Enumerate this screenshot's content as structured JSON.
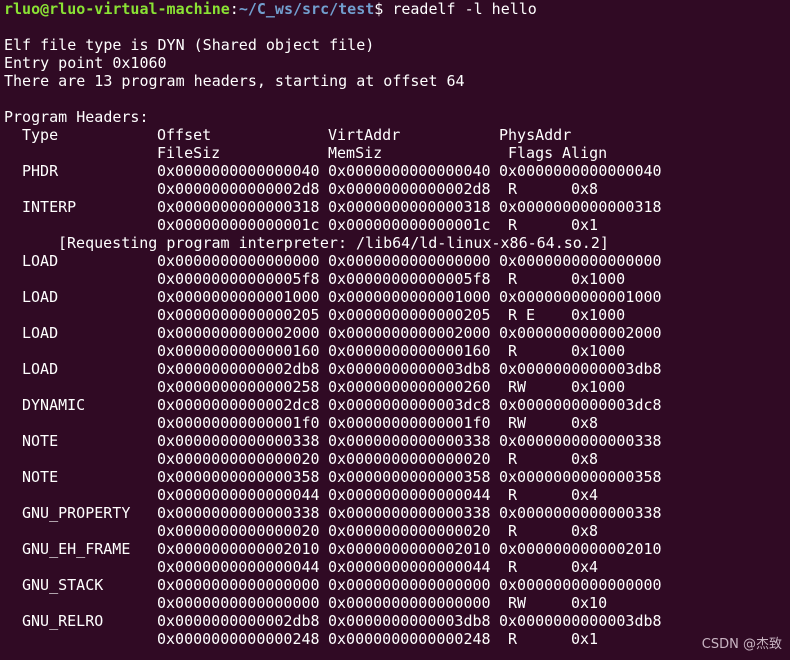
{
  "prompt": {
    "user_host": "rluo@rluo-virtual-machine",
    "separator": ":",
    "path": "~/C_ws/src/test",
    "symbol": "$ ",
    "command": "readelf -l hello"
  },
  "info": {
    "file_type": "Elf file type is DYN (Shared object file)",
    "entry_point": "Entry point 0x1060",
    "header_count": "There are 13 program headers, starting at offset 64"
  },
  "headers_title": "Program Headers:",
  "columns": {
    "type": "Type",
    "offset": "Offset",
    "virtaddr": "VirtAddr",
    "physaddr": "PhysAddr",
    "filesiz": "FileSiz",
    "memsiz": "MemSiz",
    "flags": "Flags",
    "align": "Align"
  },
  "rows": [
    {
      "type": "PHDR",
      "offset": "0x0000000000000040",
      "virtaddr": "0x0000000000000040",
      "physaddr": "0x0000000000000040",
      "filesiz": "0x00000000000002d8",
      "memsiz": "0x00000000000002d8",
      "flags": "R",
      "align": "0x8"
    },
    {
      "type": "INTERP",
      "offset": "0x0000000000000318",
      "virtaddr": "0x0000000000000318",
      "physaddr": "0x0000000000000318",
      "filesiz": "0x000000000000001c",
      "memsiz": "0x000000000000001c",
      "flags": "R",
      "align": "0x1",
      "note": "[Requesting program interpreter: /lib64/ld-linux-x86-64.so.2]"
    },
    {
      "type": "LOAD",
      "offset": "0x0000000000000000",
      "virtaddr": "0x0000000000000000",
      "physaddr": "0x0000000000000000",
      "filesiz": "0x00000000000005f8",
      "memsiz": "0x00000000000005f8",
      "flags": "R",
      "align": "0x1000"
    },
    {
      "type": "LOAD",
      "offset": "0x0000000000001000",
      "virtaddr": "0x0000000000001000",
      "physaddr": "0x0000000000001000",
      "filesiz": "0x0000000000000205",
      "memsiz": "0x0000000000000205",
      "flags": "R E",
      "align": "0x1000"
    },
    {
      "type": "LOAD",
      "offset": "0x0000000000002000",
      "virtaddr": "0x0000000000002000",
      "physaddr": "0x0000000000002000",
      "filesiz": "0x0000000000000160",
      "memsiz": "0x0000000000000160",
      "flags": "R",
      "align": "0x1000"
    },
    {
      "type": "LOAD",
      "offset": "0x0000000000002db8",
      "virtaddr": "0x0000000000003db8",
      "physaddr": "0x0000000000003db8",
      "filesiz": "0x0000000000000258",
      "memsiz": "0x0000000000000260",
      "flags": "RW",
      "align": "0x1000"
    },
    {
      "type": "DYNAMIC",
      "offset": "0x0000000000002dc8",
      "virtaddr": "0x0000000000003dc8",
      "physaddr": "0x0000000000003dc8",
      "filesiz": "0x00000000000001f0",
      "memsiz": "0x00000000000001f0",
      "flags": "RW",
      "align": "0x8"
    },
    {
      "type": "NOTE",
      "offset": "0x0000000000000338",
      "virtaddr": "0x0000000000000338",
      "physaddr": "0x0000000000000338",
      "filesiz": "0x0000000000000020",
      "memsiz": "0x0000000000000020",
      "flags": "R",
      "align": "0x8"
    },
    {
      "type": "NOTE",
      "offset": "0x0000000000000358",
      "virtaddr": "0x0000000000000358",
      "physaddr": "0x0000000000000358",
      "filesiz": "0x0000000000000044",
      "memsiz": "0x0000000000000044",
      "flags": "R",
      "align": "0x4"
    },
    {
      "type": "GNU_PROPERTY",
      "offset": "0x0000000000000338",
      "virtaddr": "0x0000000000000338",
      "physaddr": "0x0000000000000338",
      "filesiz": "0x0000000000000020",
      "memsiz": "0x0000000000000020",
      "flags": "R",
      "align": "0x8"
    },
    {
      "type": "GNU_EH_FRAME",
      "offset": "0x0000000000002010",
      "virtaddr": "0x0000000000002010",
      "physaddr": "0x0000000000002010",
      "filesiz": "0x0000000000000044",
      "memsiz": "0x0000000000000044",
      "flags": "R",
      "align": "0x4"
    },
    {
      "type": "GNU_STACK",
      "offset": "0x0000000000000000",
      "virtaddr": "0x0000000000000000",
      "physaddr": "0x0000000000000000",
      "filesiz": "0x0000000000000000",
      "memsiz": "0x0000000000000000",
      "flags": "RW",
      "align": "0x10"
    },
    {
      "type": "GNU_RELRO",
      "offset": "0x0000000000002db8",
      "virtaddr": "0x0000000000003db8",
      "physaddr": "0x0000000000003db8",
      "filesiz": "0x0000000000000248",
      "memsiz": "0x0000000000000248",
      "flags": "R",
      "align": "0x1"
    }
  ],
  "watermark": "CSDN @杰致",
  "colors": {
    "background": "#300a24",
    "user_host": "#8ae234",
    "path": "#729fcf",
    "text": "#ffffff"
  }
}
